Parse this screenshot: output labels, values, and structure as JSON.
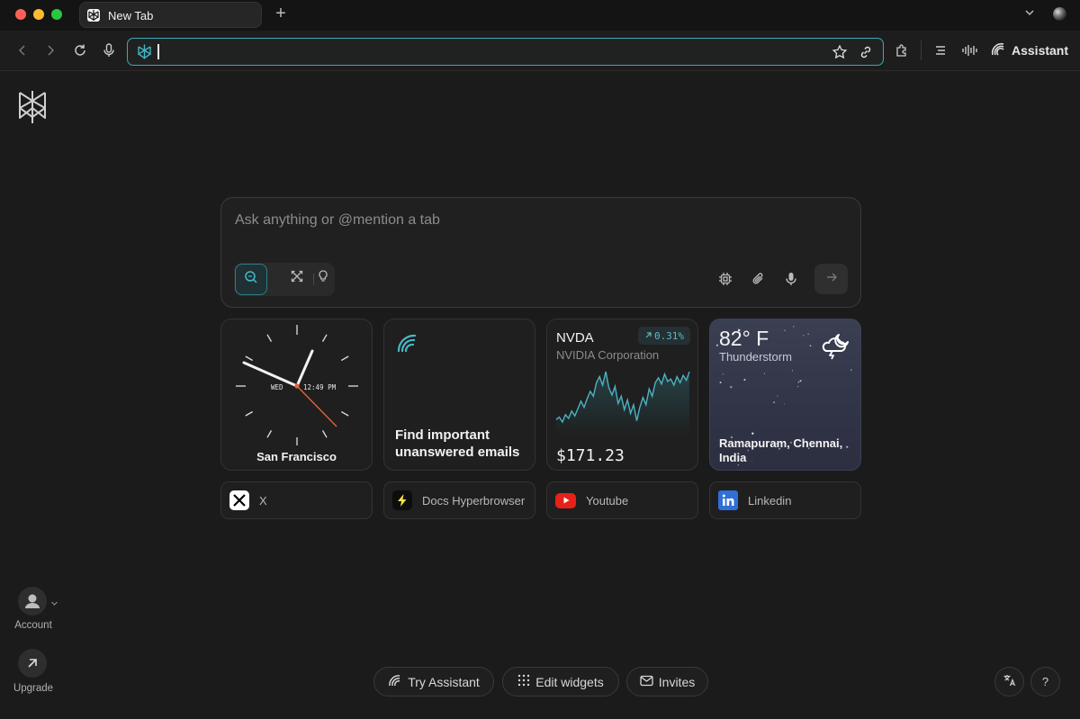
{
  "browser": {
    "tab_title": "New Tab",
    "new_tab_symbol": "+",
    "url_value": "",
    "assistant_label": "Assistant",
    "traffic_colors": [
      "#fe5f57",
      "#febc2e",
      "#28c840"
    ],
    "accent": "#3aa9b9"
  },
  "sidebar": {
    "account_label": "Account",
    "upgrade_label": "Upgrade"
  },
  "ask": {
    "placeholder": "Ask anything or @mention a tab"
  },
  "widgets": {
    "clock": {
      "day": "WED",
      "time": "12:49 PM",
      "city": "San Francisco"
    },
    "email": {
      "text": "Find important unanswered emails"
    },
    "stock": {
      "ticker": "NVDA",
      "name": "NVIDIA Corporation",
      "change": "0.31%",
      "price": "$171.23",
      "series": [
        168.9,
        169.1,
        168.7,
        169.3,
        169.0,
        169.6,
        169.2,
        169.8,
        170.4,
        169.9,
        170.6,
        171.2,
        170.8,
        171.9,
        172.4,
        171.7,
        172.8,
        171.5,
        170.9,
        171.6,
        170.2,
        170.8,
        169.7,
        170.5,
        169.4,
        170.1,
        168.8,
        169.9,
        170.7,
        170.1,
        171.4,
        170.8,
        171.9,
        172.3,
        171.8,
        172.6,
        172.0,
        172.2,
        171.7,
        172.4,
        171.9,
        172.5,
        172.1,
        172.8
      ]
    },
    "weather": {
      "temp": "82° F",
      "condition": "Thunderstorm",
      "location": "Ramapuram, Chennai, India"
    }
  },
  "shortcuts": [
    {
      "label": "X",
      "icon": "x-logo-icon",
      "bg": "#ffffff"
    },
    {
      "label": "Docs Hyperbrowser",
      "icon": "lightning-icon",
      "bg": "#0d0d0d"
    },
    {
      "label": "Youtube",
      "icon": "youtube-icon",
      "bg": "#e62117"
    },
    {
      "label": "Linkedin",
      "icon": "linkedin-icon",
      "bg": "#2f6fd6"
    }
  ],
  "bottom": {
    "try_assistant": "Try Assistant",
    "edit_widgets": "Edit widgets",
    "invites": "Invites",
    "help": "?"
  }
}
